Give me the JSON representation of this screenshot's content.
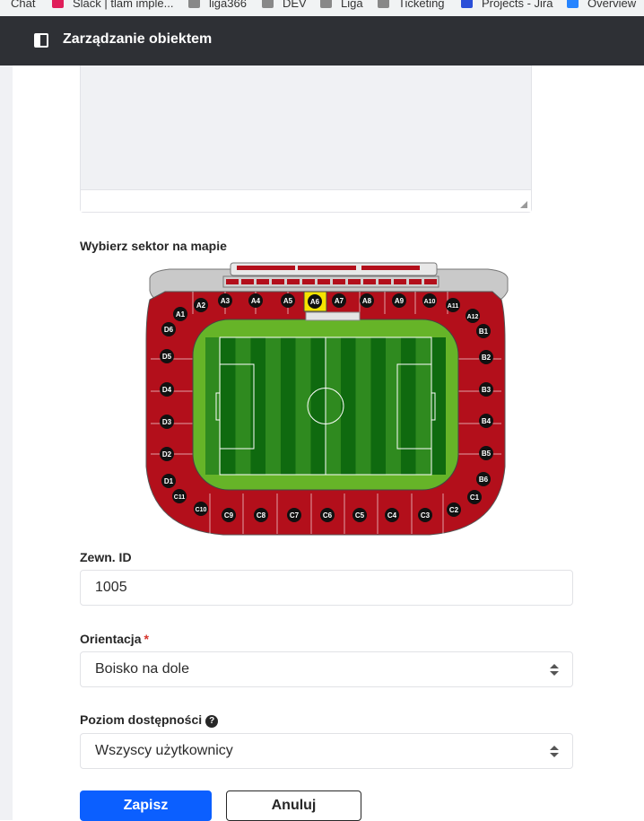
{
  "bookmarks": [
    {
      "label": "Chat",
      "color": "#888888"
    },
    {
      "label": "Slack | tlam imple...",
      "color": "#e01e5a"
    },
    {
      "label": "liga366",
      "color": "#9a9a9a"
    },
    {
      "label": "DEV",
      "color": "#9a9a9a"
    },
    {
      "label": "Liga",
      "color": "#9a9a9a"
    },
    {
      "label": "Ticketing",
      "color": "#9a9a9a"
    },
    {
      "label": "Projects - Jira",
      "color": "#2684ff"
    },
    {
      "label": "Overview",
      "color": "#2684ff"
    }
  ],
  "header": {
    "title": "Zarządzanie obiektem"
  },
  "map": {
    "label": "Wybierz sektor na mapie",
    "selected_sector": "A6",
    "colors": {
      "sector": "#b30f1b",
      "selected": "#f5e300",
      "roof": "#c9c9c9",
      "pitch": "#2f8a1f",
      "stripe": "#0f6a0f"
    },
    "sectors_top": [
      "A1",
      "A2",
      "A3",
      "A4",
      "A5",
      "A6",
      "A7",
      "A8",
      "A9",
      "A10",
      "A11",
      "A12"
    ],
    "sectors_right": [
      "B1",
      "B2",
      "B3",
      "B4",
      "B5",
      "B6"
    ],
    "sectors_bottom": [
      "C1",
      "C2",
      "C3",
      "C4",
      "C5",
      "C6",
      "C7",
      "C8",
      "C9",
      "C10",
      "C11"
    ],
    "sectors_left": [
      "D1",
      "D2",
      "D3",
      "D4",
      "D5",
      "D6"
    ]
  },
  "ext_id": {
    "label": "Zewn. ID",
    "value": "1005"
  },
  "orientation": {
    "label": "Orientacja",
    "required_mark": "*",
    "value": "Boisko na dole"
  },
  "access": {
    "label": "Poziom dostępności",
    "help_icon": "help-icon",
    "help_glyph": "?",
    "value": "Wszyscy użytkownicy"
  },
  "actions": {
    "save": "Zapisz",
    "cancel": "Anuluj"
  }
}
